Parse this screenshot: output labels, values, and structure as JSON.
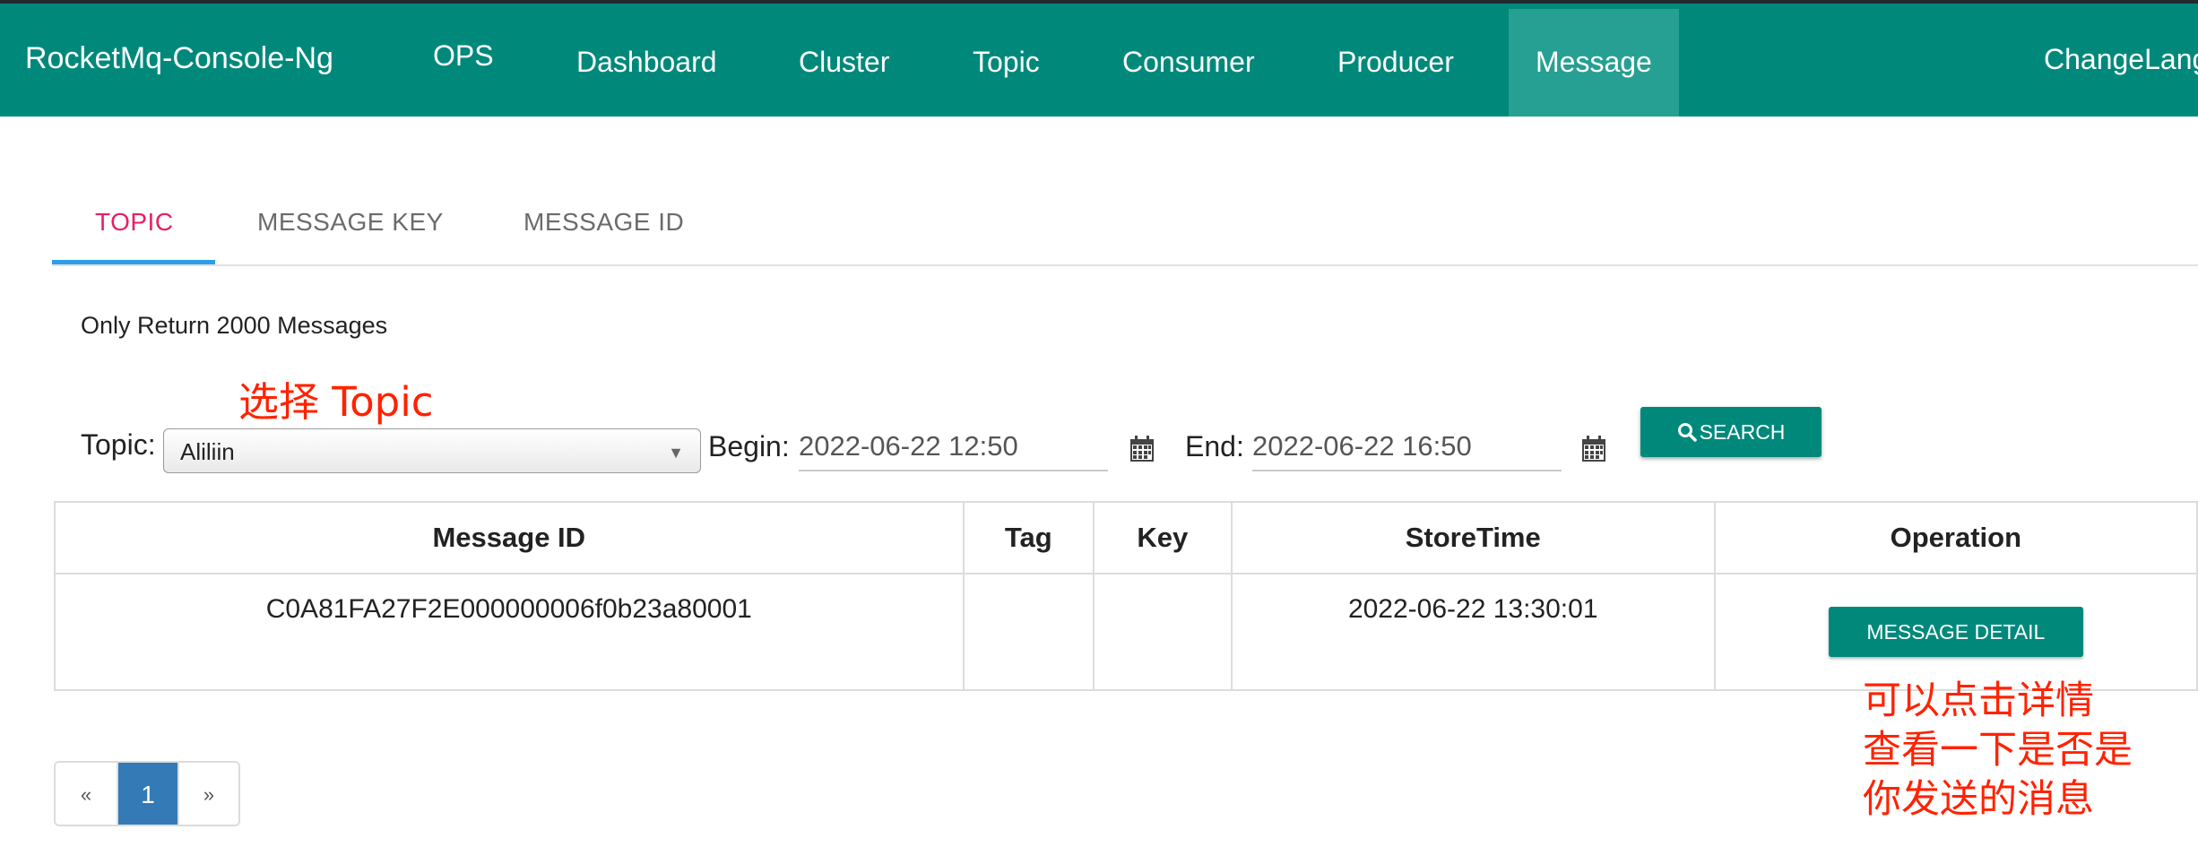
{
  "navbar": {
    "brand": "RocketMq-Console-Ng",
    "items": [
      {
        "label": "OPS"
      },
      {
        "label": "Dashboard"
      },
      {
        "label": "Cluster"
      },
      {
        "label": "Topic"
      },
      {
        "label": "Consumer"
      },
      {
        "label": "Producer"
      },
      {
        "label": "Message"
      }
    ],
    "active_item": "Message",
    "change_lang": "ChangeLang",
    "bg_color": "#00897b"
  },
  "tabs": [
    {
      "label": "TOPIC",
      "active": true
    },
    {
      "label": "MESSAGE KEY",
      "active": false
    },
    {
      "label": "MESSAGE ID",
      "active": false
    }
  ],
  "note": "Only Return 2000 Messages",
  "annotations": {
    "select_topic": "选择 Topic",
    "detail_hint_lines": [
      "可以点击详情",
      "查看一下是否是",
      "你发送的消息"
    ]
  },
  "filters": {
    "topic_label": "Topic:",
    "topic_value": "Aliliin",
    "begin_label": "Begin:",
    "begin_value": "2022-06-22 12:50",
    "end_label": "End:",
    "end_value": "2022-06-22 16:50",
    "search_label": "SEARCH",
    "calendar_icon": "calendar-icon",
    "search_icon": "search-icon"
  },
  "table": {
    "headers": [
      "Message ID",
      "Tag",
      "Key",
      "StoreTime",
      "Operation"
    ],
    "rows": [
      {
        "message_id": "C0A81FA27F2E000000006f0b23a80001",
        "tag": "",
        "key": "",
        "store_time": "2022-06-22 13:30:01",
        "operation_label": "MESSAGE DETAIL"
      }
    ]
  },
  "pagination": {
    "prev": "«",
    "pages": [
      "1"
    ],
    "current": "1",
    "next": "»"
  }
}
